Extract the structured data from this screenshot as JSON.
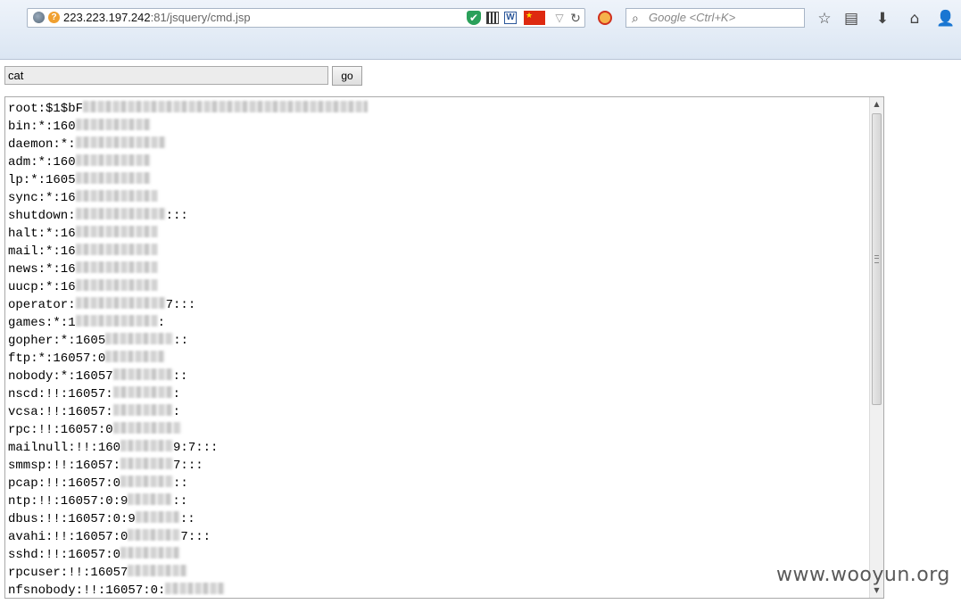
{
  "browser": {
    "url_host": "223.223.197.242",
    "url_rest": ":81/jsquery/cmd.jsp",
    "search_placeholder": "Google <Ctrl+K>",
    "flag_glyph": "★",
    "icons": [
      "globe-icon",
      "warning-icon",
      "shield-icon",
      "qr-code-icon",
      "word-icon",
      "china-flag-icon",
      "dropdown-icon",
      "reload-icon",
      "adblock-icon",
      "search-icon",
      "bookmark-star-icon",
      "reading-list-icon",
      "download-icon",
      "home-icon",
      "account-icon"
    ]
  },
  "form": {
    "command_value": "cat",
    "go_label": "go"
  },
  "output": {
    "lines": [
      {
        "text": "root:$1$bF",
        "blur_chars": 38
      },
      {
        "text": "bin:*:160",
        "blur_chars": 10
      },
      {
        "text": "daemon:*:",
        "blur_chars": 12
      },
      {
        "text": "adm:*:160",
        "blur_chars": 10
      },
      {
        "text": "lp:*:1605",
        "blur_chars": 10
      },
      {
        "text": "sync:*:16",
        "blur_chars": 11
      },
      {
        "text": "shutdown:",
        "blur_chars": 12,
        "tail": ":::"
      },
      {
        "text": "halt:*:16",
        "blur_chars": 11
      },
      {
        "text": "mail:*:16",
        "blur_chars": 11
      },
      {
        "text": "news:*:16",
        "blur_chars": 11
      },
      {
        "text": "uucp:*:16",
        "blur_chars": 11
      },
      {
        "text": "operator:",
        "blur_chars": 12,
        "tail": "7:::"
      },
      {
        "text": "games:*:1",
        "blur_chars": 11,
        "tail": ":"
      },
      {
        "text": "gopher:*:1605",
        "blur_chars": 9,
        "tail": "::"
      },
      {
        "text": "ftp:*:16057:0",
        "blur_chars": 8
      },
      {
        "text": "nobody:*:16057",
        "blur_chars": 8,
        "tail": "::"
      },
      {
        "text": "nscd:!!:16057:",
        "blur_chars": 8,
        "tail": ":"
      },
      {
        "text": "vcsa:!!:16057:",
        "blur_chars": 8,
        "tail": ":"
      },
      {
        "text": "rpc:!!:16057:0",
        "blur_chars": 9
      },
      {
        "text": "mailnull:!!:160",
        "blur_chars": 7,
        "tail": "9:7:::"
      },
      {
        "text": "smmsp:!!:16057:",
        "blur_chars": 7,
        "tail": "7:::"
      },
      {
        "text": "pcap:!!:16057:0",
        "blur_chars": 7,
        "tail": "::"
      },
      {
        "text": "ntp:!!:16057:0:9",
        "blur_chars": 6,
        "tail": "::"
      },
      {
        "text": "dbus:!!:16057:0:9",
        "blur_chars": 6,
        "tail": "::"
      },
      {
        "text": "avahi:!!:16057:0",
        "blur_chars": 7,
        "tail": "7:::"
      },
      {
        "text": "sshd:!!:16057:0",
        "blur_chars": 8
      },
      {
        "text": "rpcuser:!!:16057",
        "blur_chars": 8
      },
      {
        "text": "nfsnobody:!!:16057:0:",
        "blur_chars": 8
      }
    ]
  },
  "watermark": "www.wooyun.org"
}
